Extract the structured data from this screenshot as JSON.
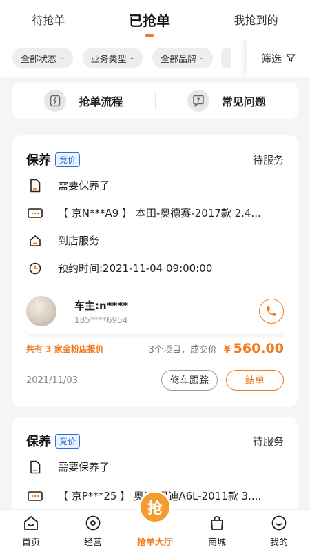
{
  "tabs": [
    {
      "label": "待抢单"
    },
    {
      "label": "已抢单",
      "active": true
    },
    {
      "label": "我抢到的"
    }
  ],
  "filters": {
    "chips": [
      {
        "label": "全部状态"
      },
      {
        "label": "业务类型"
      },
      {
        "label": "全部品牌"
      }
    ],
    "filter_label": "筛选"
  },
  "quick_links": [
    {
      "label": "抢单流程",
      "icon": "flow-icon"
    },
    {
      "label": "常见问题",
      "icon": "question-icon"
    }
  ],
  "orders": [
    {
      "service": "保养",
      "badge": "竞价",
      "status": "待服务",
      "need": "需要保养了",
      "vehicle": "【 京N***A9 】 本田-奥德赛-2017款 2.4...",
      "mode": "到店服务",
      "appointment": "预约时间:2021-11-04 09:00:00",
      "owner_name": "车主:n****",
      "owner_phone": "185****6954",
      "quote_left": "共有 3 家金粉店报价",
      "quote_mid": "3个项目，成交价",
      "currency": "¥",
      "price": "560.00",
      "date": "2021/11/03",
      "btn_track": "修车跟踪",
      "btn_done": "结单"
    },
    {
      "service": "保养",
      "badge": "竞价",
      "status": "待服务",
      "need": "需要保养了",
      "vehicle": "【 京P***25 】 奥迪-奥迪A6L-2011款 3...."
    }
  ],
  "bottom_nav": [
    {
      "label": "首页",
      "icon": "home-icon"
    },
    {
      "label": "经营",
      "icon": "target-icon"
    },
    {
      "label": "抢单大厅",
      "icon": "grab-icon",
      "glyph": "抢",
      "active": true
    },
    {
      "label": "商城",
      "icon": "bag-icon"
    },
    {
      "label": "我的",
      "icon": "smile-icon"
    }
  ],
  "colors": {
    "accent": "#f07a1d",
    "badge": "#2b6fd8"
  }
}
